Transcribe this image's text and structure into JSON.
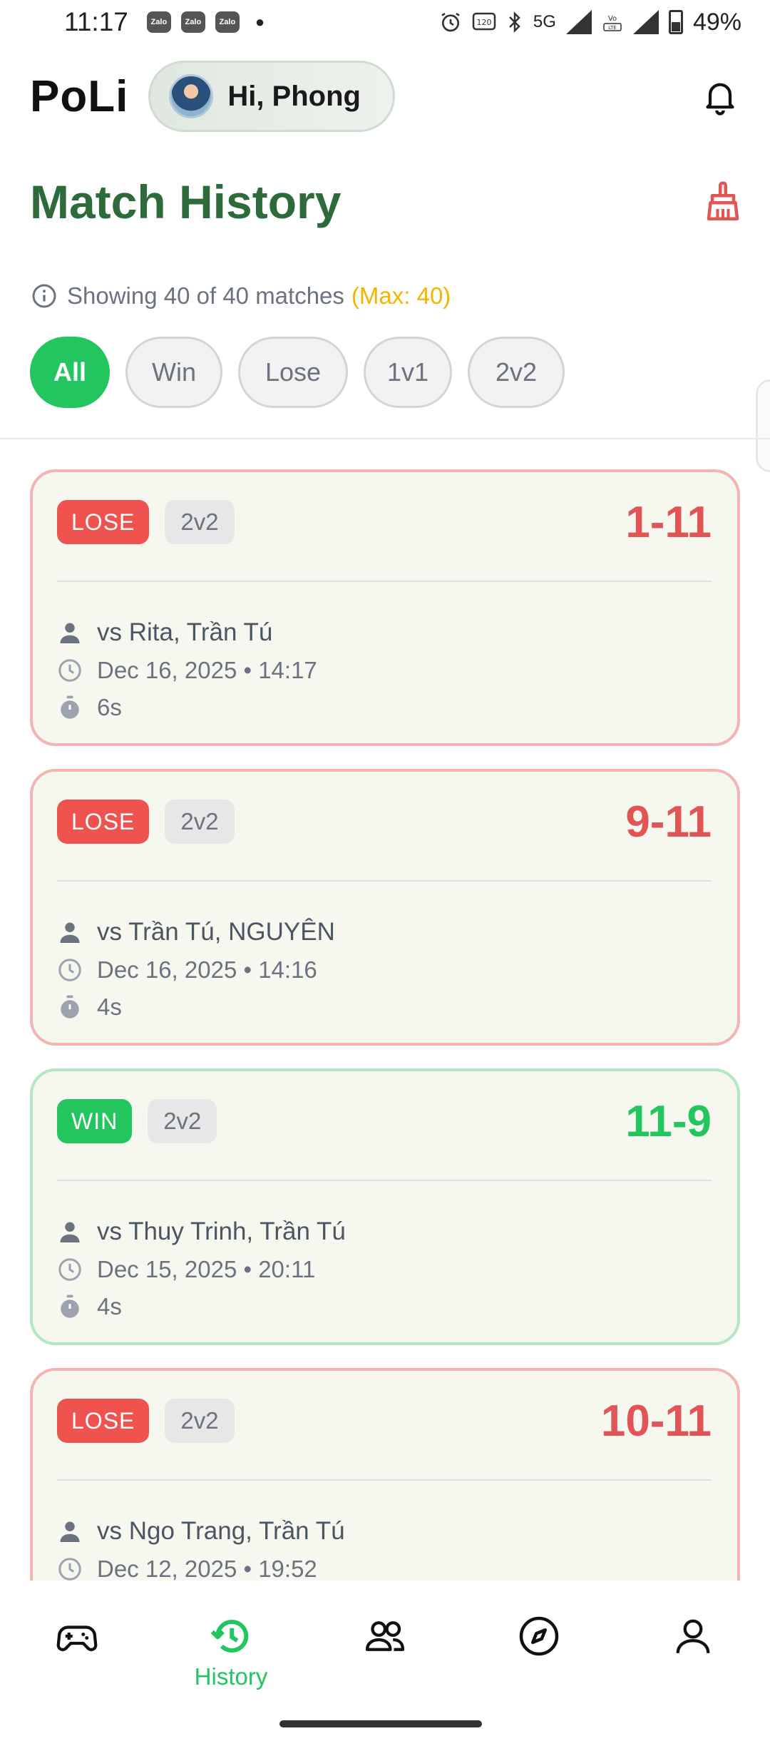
{
  "status_bar": {
    "time": "11:17",
    "notification_icons": [
      "Zalo",
      "Zalo",
      "Zalo"
    ],
    "right_icons": [
      "alarm-icon",
      "120hz-icon",
      "bluetooth-icon",
      "5g-icon",
      "signal-icon",
      "volte-icon",
      "signal-icon",
      "battery-icon"
    ],
    "network": "5G",
    "battery": "49%"
  },
  "header": {
    "logo": "PoLi",
    "greeting": "Hi, Phong"
  },
  "page": {
    "title": "Match History",
    "info_text": "Showing 40 of 40 matches",
    "max_text": "(Max: 40)"
  },
  "filters": [
    {
      "label": "All",
      "active": true
    },
    {
      "label": "Win",
      "active": false
    },
    {
      "label": "Lose",
      "active": false
    },
    {
      "label": "1v1",
      "active": false
    },
    {
      "label": "2v2",
      "active": false
    }
  ],
  "matches": [
    {
      "result": "LOSE",
      "mode": "2v2",
      "score": "1-11",
      "opponents": "vs Rita, Trần Tú",
      "datetime": "Dec 16, 2025 • 14:17",
      "duration": "6s"
    },
    {
      "result": "LOSE",
      "mode": "2v2",
      "score": "9-11",
      "opponents": "vs Trần Tú, NGUYÊN",
      "datetime": "Dec 16, 2025 • 14:16",
      "duration": "4s"
    },
    {
      "result": "WIN",
      "mode": "2v2",
      "score": "11-9",
      "opponents": "vs Thuy Trinh, Trần Tú",
      "datetime": "Dec 15, 2025 • 20:11",
      "duration": "4s"
    },
    {
      "result": "LOSE",
      "mode": "2v2",
      "score": "10-11",
      "opponents": "vs Ngo Trang, Trần Tú",
      "datetime": "Dec 12, 2025 • 19:52",
      "duration": ""
    }
  ],
  "bottom_nav": {
    "items": [
      {
        "icon": "gamepad-icon",
        "label": ""
      },
      {
        "icon": "history-icon",
        "label": "History",
        "active": true
      },
      {
        "icon": "friends-icon",
        "label": ""
      },
      {
        "icon": "compass-icon",
        "label": ""
      },
      {
        "icon": "profile-icon",
        "label": ""
      }
    ]
  },
  "colors": {
    "title_green": "#2e6b3a",
    "accent_green": "#22c55e",
    "lose_red": "#ef5350",
    "max_yellow": "#f4b400"
  }
}
